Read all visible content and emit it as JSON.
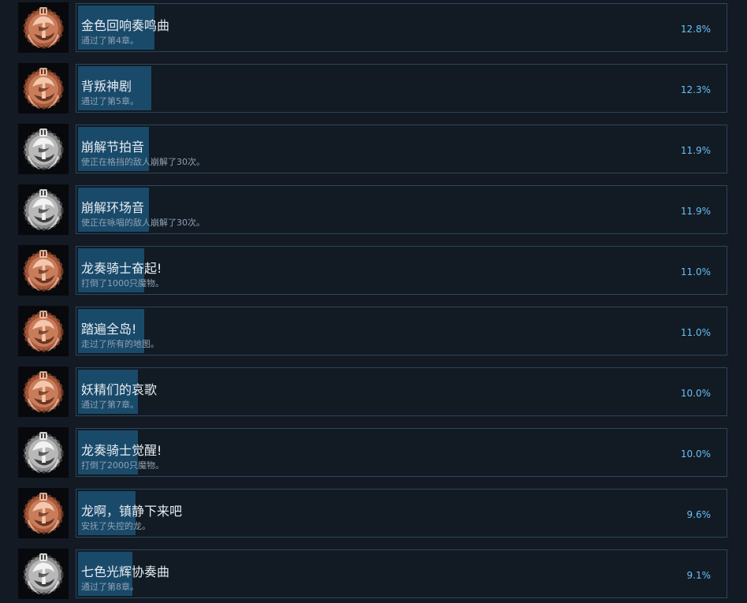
{
  "colors": {
    "background": "#131a23",
    "panel_border": "#2a475e",
    "progress_fill": "#1a4a6a",
    "title_text": "#e6ecf1",
    "description_text": "#8fa1b3",
    "percent_text": "#66c0f4",
    "badge_bronze": "#c97c5a",
    "badge_silver": "#b8b8b8"
  },
  "achievements": [
    {
      "title": "金色回响奏鸣曲",
      "description": "通过了第4章。",
      "percent": "12.8%",
      "rate": 0.128,
      "icon": "bronze-achievement-badge-icon",
      "tone": "bronze"
    },
    {
      "title": "背叛神剧",
      "description": "通过了第5章。",
      "percent": "12.3%",
      "rate": 0.123,
      "icon": "bronze-achievement-badge-icon",
      "tone": "bronze"
    },
    {
      "title": "崩解节拍音",
      "description": "使正在格挡的敌人崩解了30次。",
      "percent": "11.9%",
      "rate": 0.119,
      "icon": "silver-achievement-badge-icon",
      "tone": "silver"
    },
    {
      "title": "崩解环场音",
      "description": "使正在咏唱的敌人崩解了30次。",
      "percent": "11.9%",
      "rate": 0.119,
      "icon": "silver-achievement-badge-icon",
      "tone": "silver"
    },
    {
      "title": "龙奏骑士奋起!",
      "description": "打倒了1000只魔物。",
      "percent": "11.0%",
      "rate": 0.11,
      "icon": "bronze-achievement-badge-icon",
      "tone": "bronze"
    },
    {
      "title": "踏遍全岛!",
      "description": "走过了所有的地图。",
      "percent": "11.0%",
      "rate": 0.11,
      "icon": "bronze-achievement-badge-icon",
      "tone": "bronze"
    },
    {
      "title": "妖精们的哀歌",
      "description": "通过了第7章。",
      "percent": "10.0%",
      "rate": 0.1,
      "icon": "bronze-achievement-badge-icon",
      "tone": "bronze"
    },
    {
      "title": "龙奏骑士觉醒!",
      "description": "打倒了2000只魔物。",
      "percent": "10.0%",
      "rate": 0.1,
      "icon": "silver-achievement-badge-icon",
      "tone": "silver"
    },
    {
      "title": "龙啊，镇静下来吧",
      "description": "安抚了失控的龙。",
      "percent": "9.6%",
      "rate": 0.096,
      "icon": "bronze-achievement-badge-icon",
      "tone": "bronze"
    },
    {
      "title": "七色光辉协奏曲",
      "description": "通过了第8章。",
      "percent": "9.1%",
      "rate": 0.091,
      "icon": "silver-achievement-badge-icon",
      "tone": "silver"
    }
  ]
}
